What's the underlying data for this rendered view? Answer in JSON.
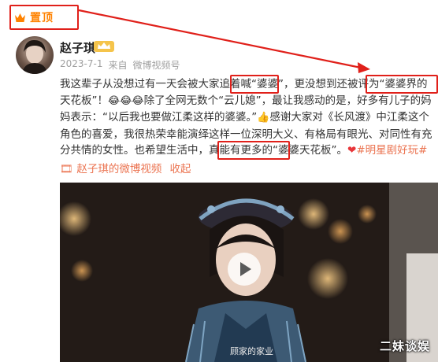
{
  "pin": {
    "label": "置顶",
    "icon": "crown-icon",
    "color": "#ff8200"
  },
  "user": {
    "name": "赵子琪",
    "badge_icon": "vip-crown-icon"
  },
  "post_meta": {
    "date": "2023-7-1",
    "source_prefix": "来自",
    "source": "微博视频号"
  },
  "content": {
    "seg1": "我这辈子从没想过有一天会被大家追着喊“婆婆”，更没想到还被评为“婆婆界的天花板”！",
    "emojis": "😂😂😂",
    "seg2": "除了全网无数个“云儿媳”，最让我感动的是，好多有儿子的妈妈表示：“以后我也要做江柔这样的婆婆。”",
    "emoji_thumb": "👍",
    "seg3": "感谢大家对《长风渡》中江柔这个角色的喜爱，我很热荣幸能演绎这样一位深明大义、有格局有眼光、对同性有充分共情的女性。也希望生活中，真能有更多的“婆婆天花板”。",
    "heart": "❤",
    "topic": "#明星剧好玩#",
    "video_link": "🎞 赵子琪的微博视频",
    "collapse": "收起"
  },
  "video": {
    "subtitle": "顾家的家业",
    "play_icon": "play-icon"
  },
  "watermark": "二妹谈娱",
  "colors": {
    "highlight_box": "#e0201a",
    "link": "#eb7350"
  }
}
